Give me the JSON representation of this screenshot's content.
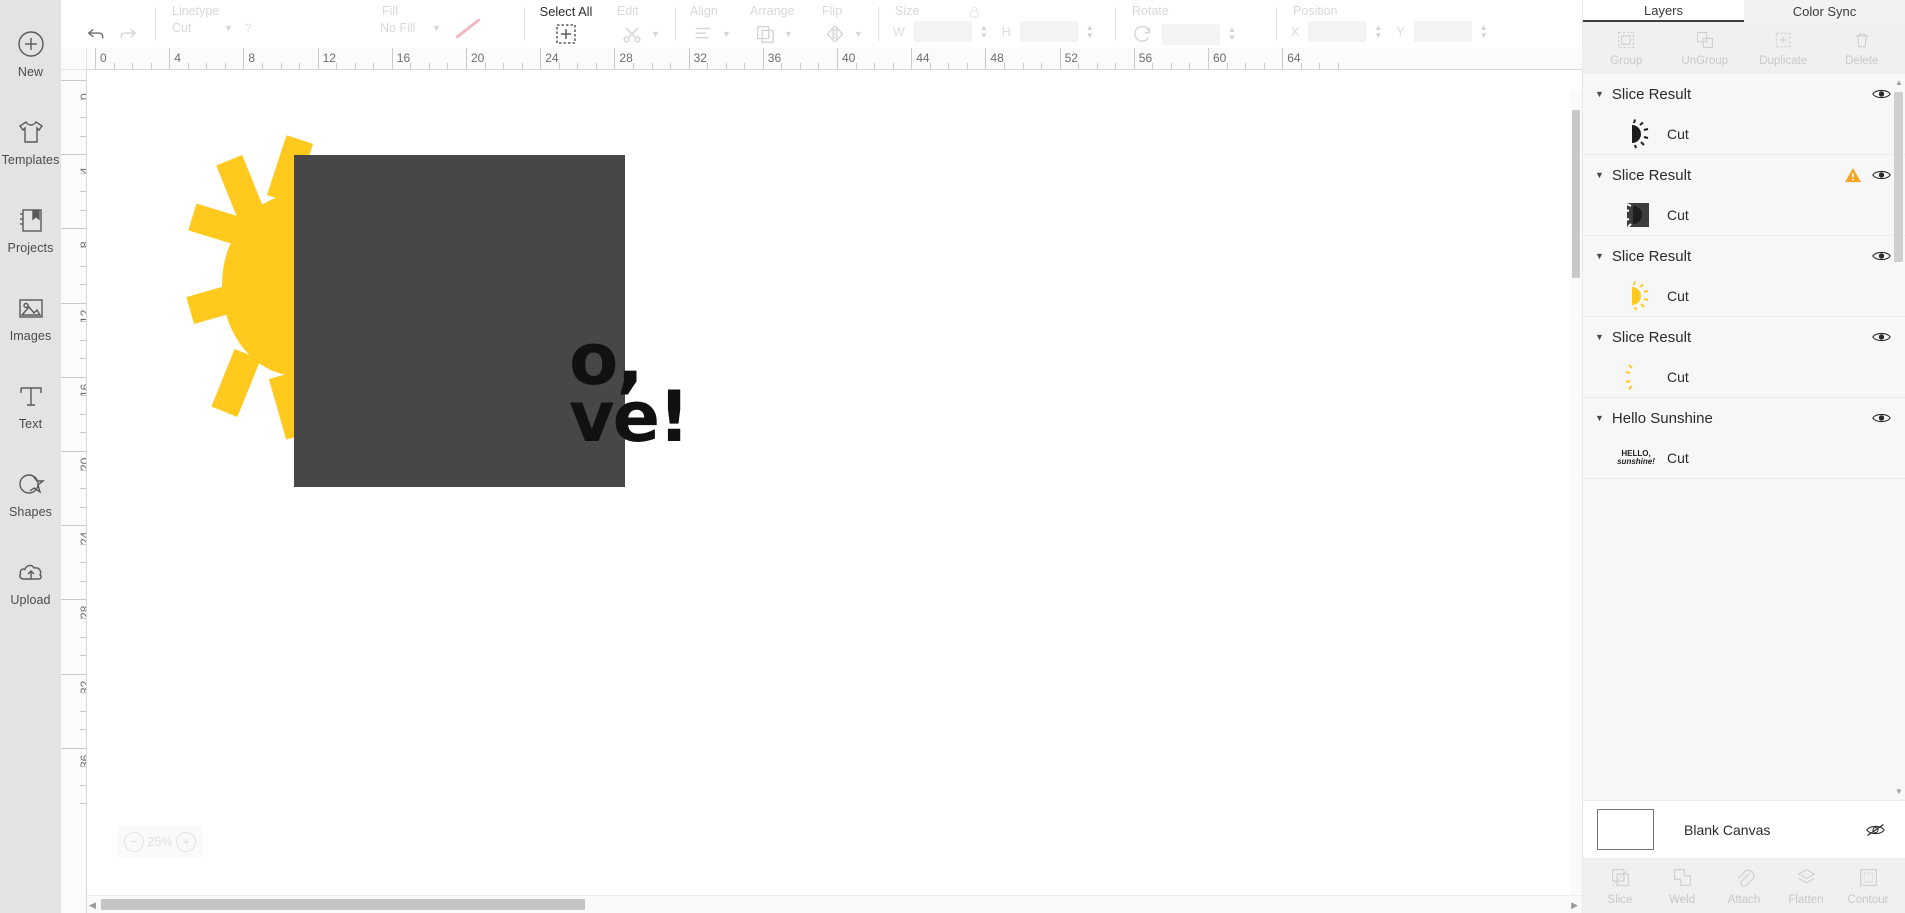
{
  "sidebar": {
    "items": [
      {
        "label": "New",
        "icon": "plus-circle-icon"
      },
      {
        "label": "Templates",
        "icon": "tshirt-icon"
      },
      {
        "label": "Projects",
        "icon": "book-bookmark-icon"
      },
      {
        "label": "Images",
        "icon": "picture-icon"
      },
      {
        "label": "Text",
        "icon": "text-t-icon"
      },
      {
        "label": "Shapes",
        "icon": "shapes-icon"
      },
      {
        "label": "Upload",
        "icon": "cloud-upload-icon"
      }
    ]
  },
  "toolbar": {
    "undo_icon": "undo-arrow-icon",
    "redo_icon": "redo-arrow-icon",
    "linetype": {
      "label": "Linetype",
      "value": "Cut",
      "help": "?"
    },
    "fill": {
      "label": "Fill",
      "value": "No Fill"
    },
    "select_all": {
      "label": "Select All",
      "icon": "select-all-plus-icon"
    },
    "edit": {
      "label": "Edit",
      "icon": "edit-scissors-icon"
    },
    "align": {
      "label": "Align",
      "icon": "align-icon"
    },
    "arrange": {
      "label": "Arrange",
      "icon": "arrange-layers-icon"
    },
    "flip": {
      "label": "Flip",
      "icon": "flip-icon"
    },
    "size": {
      "label": "Size",
      "w_label": "W",
      "h_label": "H",
      "w_value": "",
      "h_value": "",
      "lock_icon": "lock-icon"
    },
    "rotate": {
      "label": "Rotate",
      "value": "",
      "icon": "rotate-icon"
    },
    "position": {
      "label": "Position",
      "x_label": "X",
      "y_label": "Y",
      "x_value": "",
      "y_value": ""
    }
  },
  "canvas": {
    "ruler_h": [
      "0",
      "4",
      "8",
      "12",
      "16",
      "20",
      "24",
      "28",
      "32",
      "36",
      "40",
      "44",
      "48",
      "52",
      "56",
      "60",
      "64"
    ],
    "ruler_v": [
      "0",
      "4",
      "8",
      "12",
      "16",
      "20",
      "24",
      "28",
      "32",
      "36"
    ],
    "zoom": {
      "value": "25%",
      "minus": "−",
      "plus": "+"
    },
    "artwork": {
      "headline_line1": "o,",
      "headline_line2": "ve!",
      "sun_color": "#FFC91E",
      "overlay_color": "#474747",
      "text_color": "#111111"
    }
  },
  "right_panel": {
    "tabs": [
      {
        "label": "Layers",
        "selected": true
      },
      {
        "label": "Color Sync",
        "selected": false
      }
    ],
    "tools": [
      {
        "label": "Group",
        "icon": "group-icon"
      },
      {
        "label": "UnGroup",
        "icon": "ungroup-icon"
      },
      {
        "label": "Duplicate",
        "icon": "duplicate-icon"
      },
      {
        "label": "Delete",
        "icon": "trash-icon"
      }
    ],
    "layers": [
      {
        "title": "Slice Result",
        "child_label": "Cut",
        "thumb": "sun-half-dark-icon",
        "warning": false
      },
      {
        "title": "Slice Result",
        "child_label": "Cut",
        "thumb": "sun-square-dark-icon",
        "warning": true
      },
      {
        "title": "Slice Result",
        "child_label": "Cut",
        "thumb": "sun-half-yellow-icon",
        "warning": false
      },
      {
        "title": "Slice Result",
        "child_label": "Cut",
        "thumb": "sun-sliver-yellow-icon",
        "warning": false
      },
      {
        "title": "Hello Sunshine",
        "child_label": "Cut",
        "thumb": "hello-sunshine-text-icon",
        "warning": false
      }
    ],
    "canvas_row": {
      "label": "Blank Canvas",
      "eye_icon": "eye-hidden-icon"
    },
    "bottom_tools": [
      {
        "label": "Slice",
        "icon": "slice-icon"
      },
      {
        "label": "Weld",
        "icon": "weld-icon"
      },
      {
        "label": "Attach",
        "icon": "attach-paperclip-icon"
      },
      {
        "label": "Flatten",
        "icon": "flatten-icon"
      },
      {
        "label": "Contour",
        "icon": "contour-icon"
      }
    ],
    "thumb_text": {
      "line1": "HELLO,",
      "line2": "sunshine!"
    }
  }
}
